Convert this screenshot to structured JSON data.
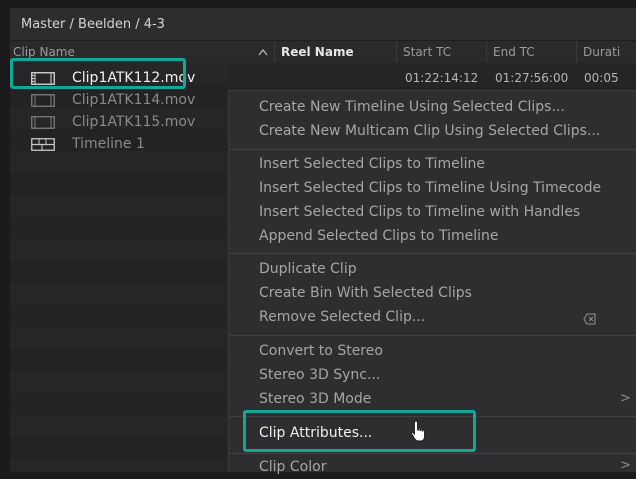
{
  "breadcrumb": "Master / Beelden / 4-3",
  "columns": {
    "clip_name": "Clip Name",
    "reel_name": "Reel Name",
    "start_tc": "Start TC",
    "end_tc": "End TC",
    "duration": "Durati"
  },
  "clips": [
    {
      "name": "Clip1ATK112.mov",
      "start_tc": "01:22:14:12",
      "end_tc": "01:27:56:00",
      "duration": "00:05",
      "icon": "film-clip-icon"
    },
    {
      "name": "Clip1ATK114.mov",
      "icon": "film-clip-icon"
    },
    {
      "name": "Clip1ATK115.mov",
      "icon": "film-clip-icon"
    },
    {
      "name": "Timeline 1",
      "icon": "timeline-icon"
    }
  ],
  "context_menu": {
    "groups": [
      [
        "Create New Timeline Using Selected Clips...",
        "Create New Multicam Clip Using Selected Clips..."
      ],
      [
        "Insert Selected Clips to Timeline",
        "Insert Selected Clips to Timeline Using Timecode",
        "Insert Selected Clips to Timeline with Handles",
        "Append Selected Clips to Timeline"
      ],
      [
        "Duplicate Clip",
        "Create Bin With Selected Clips",
        "Remove Selected Clip..."
      ],
      [
        "Convert to Stereo",
        "Stereo 3D Sync...",
        "Stereo 3D Mode"
      ],
      [
        "Clip Attributes..."
      ],
      [
        "Clip Color"
      ]
    ],
    "submenu_indicator": ">"
  },
  "colors": {
    "highlight": "#13a896",
    "background": "#262629"
  }
}
